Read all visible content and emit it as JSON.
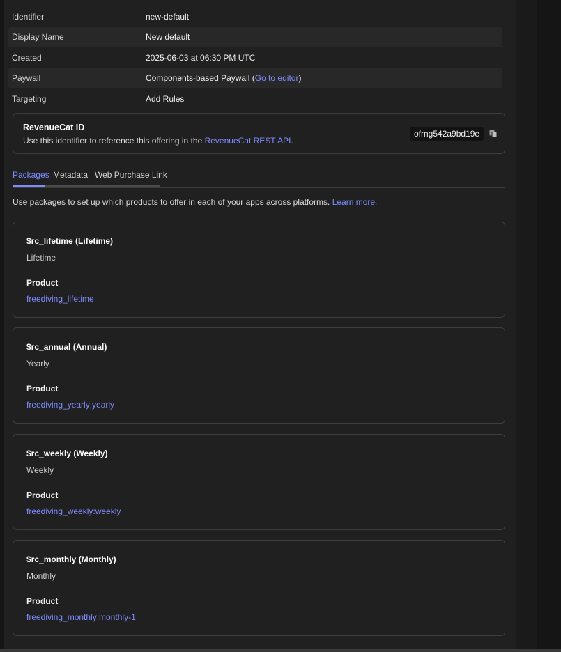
{
  "details": [
    {
      "key": "Identifier",
      "value": "new-default"
    },
    {
      "key": "Display Name",
      "value": "New default"
    },
    {
      "key": "Created",
      "value": "2025-06-03 at 06:30 PM UTC"
    },
    {
      "key": "Paywall",
      "value": "Components-based Paywall (",
      "link": "Go to editor",
      "suffix": ")"
    },
    {
      "key": "Targeting",
      "link": "Add Rules"
    }
  ],
  "revenuecat": {
    "title": "RevenueCat ID",
    "desc_prefix": "Use this identifier to reference this offering in the ",
    "desc_link": "RevenueCat REST API",
    "desc_suffix": ".",
    "id": "ofrng542a9bd19e"
  },
  "tabs": [
    "Packages",
    "Metadata",
    "Web Purchase Link"
  ],
  "intro": {
    "text": "Use packages to set up which products to offer in each of your apps across platforms. ",
    "link": "Learn more."
  },
  "packages": [
    {
      "name": "$rc_lifetime (Lifetime)",
      "duration": "Lifetime",
      "product_label": "Product",
      "product": "freediving_lifetime"
    },
    {
      "name": "$rc_annual (Annual)",
      "duration": "Yearly",
      "product_label": "Product",
      "product": "freediving_yearly:yearly"
    },
    {
      "name": "$rc_weekly (Weekly)",
      "duration": "Weekly",
      "product_label": "Product",
      "product": "freediving_weekly:weekly"
    },
    {
      "name": "$rc_monthly (Monthly)",
      "duration": "Monthly",
      "product_label": "Product",
      "product": "freediving_monthly:monthly-1"
    }
  ],
  "colors": {
    "accent": "#7f8cff",
    "panel": "#202020",
    "border": "#3d3d3d"
  }
}
